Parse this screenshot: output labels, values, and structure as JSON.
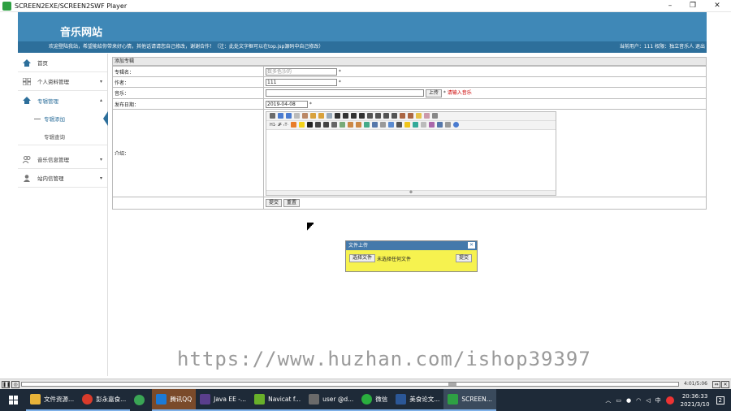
{
  "window": {
    "title": "SCREEN2EXE/SCREEN2SWF Player",
    "min": "–",
    "max": "❐",
    "close": "✕"
  },
  "site": {
    "logo": "音乐网站",
    "welcome": "欢迎登陆我站，希望能给你带来好心情，其他话请请您自己修改，谢谢合作！（注：此处文字框可以在top.jsp源码中自己修改）",
    "user_info": "当前用户：111 权限：独立音乐人 退出"
  },
  "sidebar": {
    "items": [
      {
        "label": "首页"
      },
      {
        "label": "个人资料管理",
        "chevron": "▾"
      },
      {
        "label": "专辑管理",
        "chevron": "▴"
      },
      {
        "label": "专辑添加"
      },
      {
        "label": "专辑查询"
      },
      {
        "label": "音乐信息管理",
        "chevron": "▾"
      },
      {
        "label": "站内信管理",
        "chevron": "▾"
      }
    ]
  },
  "form": {
    "header": "添加专辑",
    "album_name_label": "专辑名：",
    "album_name_placeholder": "数多色沙的",
    "album_name_req": "*",
    "author_label": "作者：",
    "author_value": "111",
    "author_req": "*",
    "music_label": "音乐：",
    "upload_btn": "上传",
    "music_req": "*",
    "music_hint": "请输入音乐",
    "date_label": "发布日期：",
    "date_value": "2019-04-08",
    "date_req": "*",
    "intro_label": "介绍：",
    "editor_toolbar_1": "H1· 𝓕· ₜT·",
    "editor_status": "✥",
    "submit_btn": "提交",
    "reset_btn": "重置"
  },
  "dialog": {
    "title": "文件上传",
    "close": "✕",
    "choose_btn": "选择文件",
    "no_file": "未选择任何文件",
    "submit_btn": "提交"
  },
  "watermark": "https://www.huzhan.com/ishop39397",
  "player": {
    "time": "4:01/5:06"
  },
  "taskbar": {
    "items": [
      {
        "label": "文件资源...",
        "color": "#e8b339"
      },
      {
        "label": "彭永嘉食...",
        "color": "#d93b2b"
      },
      {
        "label": "",
        "color": "#3aa655"
      },
      {
        "label": "腾讯QQ",
        "color": "#1c7ad6"
      },
      {
        "label": "Java EE -...",
        "color": "#5a3e8c"
      },
      {
        "label": "Navicat f...",
        "color": "#68b02a"
      },
      {
        "label": "user @d...",
        "color": "#6a6a6a"
      },
      {
        "label": "微信",
        "color": "#2aae3e"
      },
      {
        "label": "美食论文...",
        "color": "#2b5797"
      },
      {
        "label": "SCREEN...",
        "color": "#2ea043"
      }
    ],
    "tray": {
      "ime": "中",
      "time": "20:36:33",
      "date": "2021/3/10",
      "notif": "2"
    }
  }
}
